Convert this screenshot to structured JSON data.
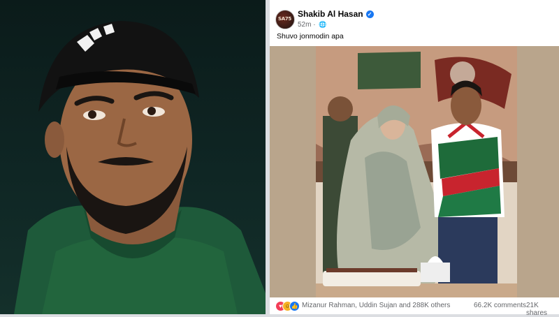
{
  "post": {
    "author": "Shakib Al Hasan",
    "avatar_text": "SA75",
    "time": "52m",
    "visibility_icon": "globe-icon",
    "caption": "Shuvo jonmodin apa",
    "reactions": {
      "icons": [
        "love-icon",
        "haha-icon",
        "like-icon"
      ],
      "reactors_text": "Mizanur Rahman, Uddin Sujan and 288K others",
      "comments_text": "66.2K comments",
      "shares_text": "21K shares"
    }
  },
  "colors": {
    "facebook_blue": "#1877f2",
    "jersey_green": "#1e6b3a",
    "jersey_red": "#c8242e"
  }
}
